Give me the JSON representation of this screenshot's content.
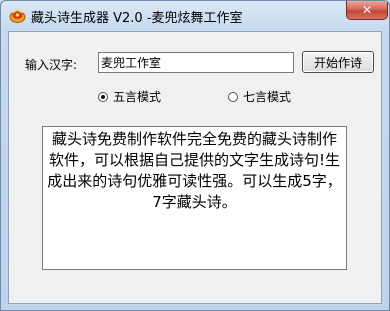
{
  "window": {
    "title": "藏头诗生成器 V2.0 -麦兜炫舞工作室",
    "close_icon": "close-x-icon",
    "app_icon": "app-logo-icon"
  },
  "form": {
    "input_label": "输入汉字:",
    "input_value": "麦兜工作室",
    "start_button_label": "开始作诗",
    "mode_options": [
      {
        "label": "五言模式",
        "selected": true
      },
      {
        "label": "七言模式",
        "selected": false
      }
    ]
  },
  "output": {
    "text": "藏头诗免费制作软件完全免费的藏头诗制作软件，可以根据自己提供的文字生成诗句!生成出来的诗句优雅可读性强。可以生成5字，7字藏头诗。"
  },
  "colors": {
    "title_bar": "#c9dcef",
    "client_bg": "#f0f0f0",
    "close_button": "#c3463a"
  }
}
